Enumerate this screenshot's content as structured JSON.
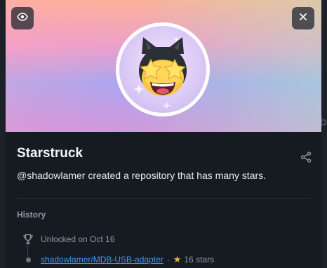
{
  "backdrop": {
    "partial_text": "ib"
  },
  "modal": {
    "achievement": {
      "title": "Starstruck",
      "description": "@shadowlamer created a repository that has many stars."
    },
    "history": {
      "label": "History",
      "unlocked_text": "Unlocked on Oct 16",
      "repo_link": "shadowlamer/MDB-USB-adapter",
      "separator": "·",
      "star_count": "16 stars"
    }
  },
  "icons": {
    "eye": "eye-icon",
    "close": "close-icon",
    "share": "share-icon",
    "trophy": "trophy-icon",
    "star": "star-icon"
  },
  "colors": {
    "link": "#4493f8",
    "star": "#e3b341",
    "modal_bg": "#161b22"
  }
}
